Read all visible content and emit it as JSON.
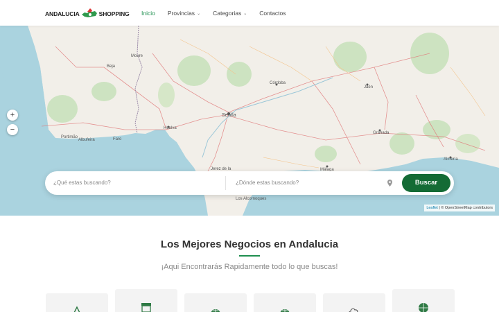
{
  "header": {
    "logo_left": "ANDALUCIA",
    "logo_right": "SHOPPING",
    "nav": [
      {
        "label": "Inicio",
        "active": true,
        "dropdown": false
      },
      {
        "label": "Provincias",
        "active": false,
        "dropdown": true
      },
      {
        "label": "Categorias",
        "active": false,
        "dropdown": true
      },
      {
        "label": "Contactos",
        "active": false,
        "dropdown": false
      }
    ]
  },
  "map": {
    "zoom_in": "+",
    "zoom_out": "−",
    "attribution_leaflet": "Leaflet",
    "attribution_rest": " | © OpenStreetMap contributors",
    "labels": {
      "sevilla": "Sevilla",
      "huelva": "Huelva",
      "cordoba": "Córdoba",
      "granada": "Granada",
      "malaga": "Málaga",
      "jaen": "Jaén",
      "almeria": "Almería",
      "beja": "Beja",
      "faro": "Faro",
      "moure": "Moure",
      "portimao": "Portimão",
      "albufeira": "Albufeira",
      "algeciras": "Los Alcornoques",
      "jerez": "Jerez de la"
    }
  },
  "search": {
    "what_placeholder": "¿Qué estas buscando?",
    "where_placeholder": "¿Dónde estas buscando?",
    "button_label": "Buscar"
  },
  "section": {
    "title": "Los Mejores Negocios en Andalucia",
    "subtitle": "¡Aqui Encontrarás Rapidamente todo lo que buscas!"
  },
  "colors": {
    "accent": "#1e8f4f",
    "button": "#146b35",
    "sea": "#aad3df",
    "land": "#f2efe9"
  },
  "categories": [
    {
      "icon": "recycle-icon"
    },
    {
      "icon": "store-icon"
    },
    {
      "icon": "globe-icon"
    },
    {
      "icon": "globe-icon"
    },
    {
      "icon": "cloud-icon"
    },
    {
      "icon": "globe-icon"
    }
  ]
}
